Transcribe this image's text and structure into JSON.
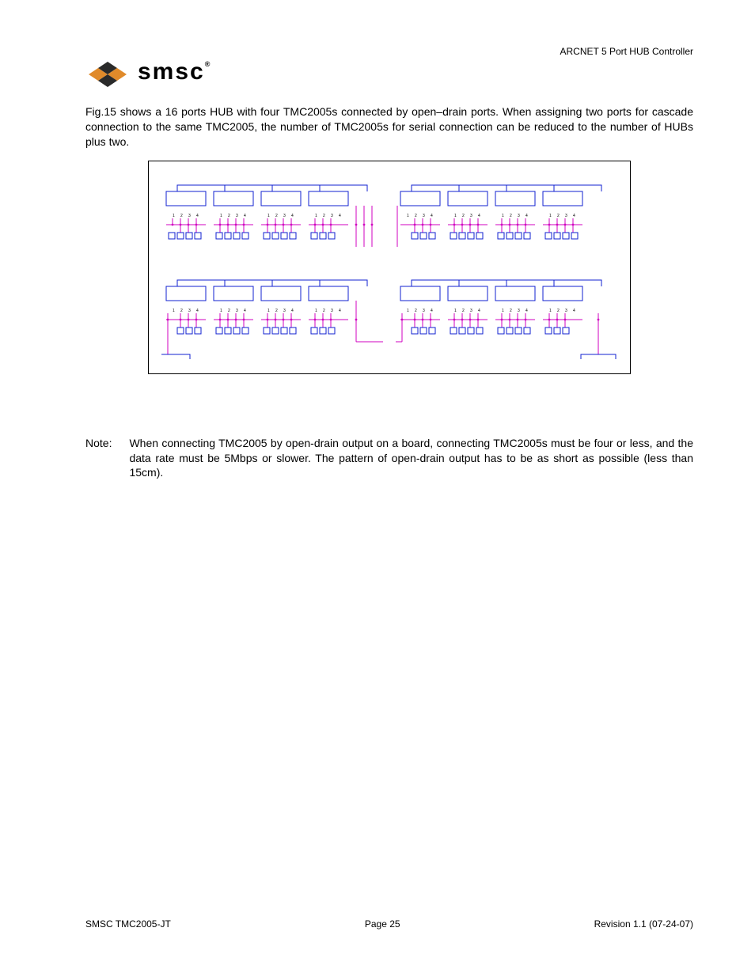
{
  "header": {
    "doc_title": "ARCNET 5 Port HUB Controller",
    "logo_text": "smsc",
    "logo_reg": "®"
  },
  "body": {
    "paragraph": "Fig.15 shows a 16 ports HUB with four TMC2005s connected by open–drain ports. When assigning two ports for cascade connection to the same TMC2005, the number of TMC2005s for serial connection can be reduced to the number of HUBs plus two."
  },
  "diagram": {
    "port_labels": [
      "1",
      "2",
      "3",
      "4"
    ]
  },
  "note": {
    "label": "Note:",
    "text": "When connecting TMC2005 by open-drain output on a board, connecting TMC2005s must be four or less, and the data rate must be 5Mbps or slower. The pattern of open-drain output has to be as short as possible (less than 15cm)."
  },
  "footer": {
    "left": "SMSC TMC2005-JT",
    "center": "Page 25",
    "right": "Revision 1.1 (07-24-07)"
  }
}
